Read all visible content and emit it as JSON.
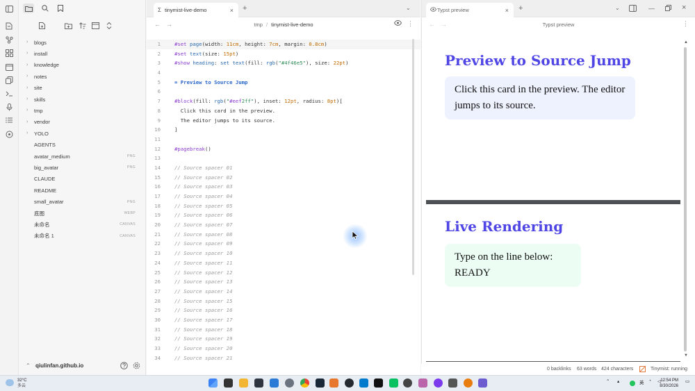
{
  "sidebar": {
    "tree": [
      {
        "label": "blogs",
        "folder": true
      },
      {
        "label": "install",
        "folder": true
      },
      {
        "label": "knowledge",
        "folder": true
      },
      {
        "label": "notes",
        "folder": true
      },
      {
        "label": "site",
        "folder": true
      },
      {
        "label": "skills",
        "folder": true
      },
      {
        "label": "tmp",
        "folder": true
      },
      {
        "label": "vendor",
        "folder": true
      },
      {
        "label": "YOLO",
        "folder": true
      },
      {
        "label": "AGENTS",
        "ext": ""
      },
      {
        "label": "avatar_medium",
        "ext": "PNG"
      },
      {
        "label": "big_avatar",
        "ext": "PNG"
      },
      {
        "label": "CLAUDE",
        "ext": ""
      },
      {
        "label": "README",
        "ext": ""
      },
      {
        "label": "small_avatar",
        "ext": "PNG"
      },
      {
        "label": "底图",
        "ext": "WEBP"
      },
      {
        "label": "未命名",
        "ext": "CANVAS"
      },
      {
        "label": "未命名 1",
        "ext": "CANVAS"
      }
    ],
    "vault_name": "qiulinfan.github.io"
  },
  "editor": {
    "tab_title": "tinymist-live-demo",
    "breadcrumb_parent": "tmp",
    "breadcrumb_sep": "/",
    "breadcrumb_file": "tinymist-live-demo",
    "lines": [
      "#set page(width: 11cm, height: 7cm, margin: 0.8cm)",
      "#set text(size: 15pt)",
      "#show heading: set text(fill: rgb(\"#4f46e5\"), size: 22pt)",
      "",
      "= Preview to Source Jump",
      "",
      "#block(fill: rgb(\"#eef2ff\"), inset: 12pt, radius: 8pt)[",
      "  Click this card in the preview.",
      "  The editor jumps to its source.",
      "]",
      "",
      "#pagebreak()",
      "",
      "// Source spacer 01",
      "// Source spacer 02",
      "// Source spacer 03",
      "// Source spacer 04",
      "// Source spacer 05",
      "// Source spacer 06",
      "// Source spacer 07",
      "// Source spacer 08",
      "// Source spacer 09",
      "// Source spacer 10",
      "// Source spacer 11",
      "// Source spacer 12",
      "// Source spacer 13",
      "// Source spacer 14",
      "// Source spacer 15",
      "// Source spacer 16",
      "// Source spacer 17",
      "// Source spacer 18",
      "// Source spacer 19",
      "// Source spacer 20",
      "// Source spacer 21"
    ]
  },
  "preview": {
    "tab_title": "Typst preview",
    "header_title": "Typst preview",
    "page1_heading": "Preview to Source Jump",
    "page1_card": "Click this card in the preview. The editor jumps to its source.",
    "page2_heading": "Live Rendering",
    "page2_card": "Type on the line below: READY",
    "heading_color": "#4f46e5",
    "card1_color": "#eef2ff",
    "card2_color": "#ecfdf3"
  },
  "status": {
    "backlinks": "0 backlinks",
    "words": "63 words",
    "characters": "424 characters",
    "tinymist": "Tinymist: running"
  },
  "taskbar": {
    "temperature": "32°C",
    "weather": "多云",
    "ime": "英",
    "time": "12:54 PM",
    "date": "8/30/2026"
  }
}
